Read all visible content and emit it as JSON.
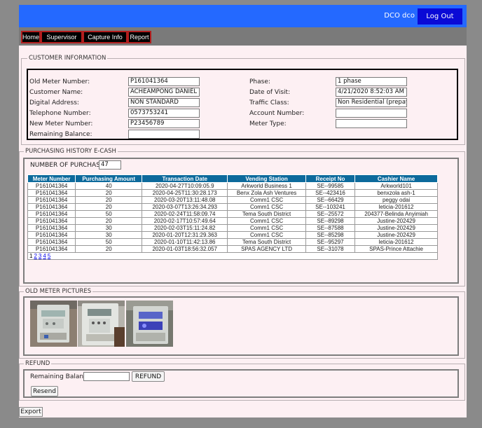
{
  "header": {
    "user": "DCO dco",
    "logout_label": "Log Out"
  },
  "nav": {
    "items": [
      "Home",
      "Supervisor",
      "Capture Info",
      "Report"
    ]
  },
  "customer": {
    "legend": "CUSTOMER INFORMATION",
    "old_meter_label": "Old Meter Number:",
    "old_meter_value": "P161041364",
    "name_label": "Customer Name:",
    "name_value": "ACHEAMPONG DANIEL",
    "digital_label": "Digital Address:",
    "digital_value": "NON STANDARD",
    "phone_label": "Telephone Number:",
    "phone_value": " 0573753241",
    "new_meter_label": "New Meter Number:",
    "new_meter_value": "P23456789",
    "balance_label": "Remaining Balance:",
    "balance_value": "",
    "phase_label": "Phase:",
    "phase_value": "1 phase",
    "visit_label": "Date of Visit:",
    "visit_value": "4/21/2020 8:52:03 AM",
    "traffic_label": "Traffic Class:",
    "traffic_value": "Non Residential (prepaym",
    "account_label": "Account Number:",
    "account_value": "",
    "meter_type_label": "Meter Type:",
    "meter_type_value": ""
  },
  "history": {
    "legend": "PURCHASING HISTORY E-CASH",
    "count_label": "NUMBER OF PURCHASES",
    "count_value": "47",
    "columns": [
      "Meter Number",
      "Purchasing Amount",
      "Transaction Date",
      "Vending Station",
      "Receipt No",
      "Cashier Name"
    ],
    "rows": [
      [
        "P161041364",
        "40",
        "2020-04-27T10:09:05.9",
        "Arkworld Business 1",
        "SE--99585",
        "Arkworld101"
      ],
      [
        "P161041364",
        "20",
        "2020-04-25T11:30:28.173",
        "Benx Zola Ash Ventures",
        "SE--423416",
        "benxzola ash-1"
      ],
      [
        "P161041364",
        "20",
        "2020-03-20T13:11:48.08",
        "Comm1 CSC",
        "SE--66429",
        "peggy odai"
      ],
      [
        "P161041364",
        "20",
        "2020-03-07T13:26:34.293",
        "Comm1 CSC",
        "SE--103241",
        "leticia-201612"
      ],
      [
        "P161041364",
        "50",
        "2020-02-24T11:58:09.74",
        "Tema South District",
        "SE--25572",
        "204377-Belinda Anyimiah"
      ],
      [
        "P161041364",
        "20",
        "2020-02-17T10:57:49.64",
        "Comm1 CSC",
        "SE--89298",
        "Justine-202429"
      ],
      [
        "P161041364",
        "30",
        "2020-02-03T15:11:24.82",
        "Comm1 CSC",
        "SE--87588",
        "Justine-202429"
      ],
      [
        "P161041364",
        "30",
        "2020-01-20T12:31:29.363",
        "Comm1 CSC",
        "SE--85298",
        "Justine-202429"
      ],
      [
        "P161041364",
        "50",
        "2020-01-10T11:42:13.86",
        "Tema South District",
        "SE--95297",
        "leticia-201612"
      ],
      [
        "P161041364",
        "20",
        "2020-01-03T18:56:32.057",
        "SPAS AGENCY LTD",
        "SE--31078",
        "SPAS-Prince Attachie"
      ]
    ],
    "pages": [
      "1",
      "2",
      "3",
      "4",
      "5"
    ]
  },
  "pictures": {
    "legend": "OLD METER PICTURES",
    "items": [
      "meter-photo-1",
      "meter-photo-2",
      "meter-photo-3"
    ]
  },
  "refund": {
    "legend": "REFUND",
    "balance_label": "Remaining Balance:",
    "balance_value": "",
    "refund_label": "REFUND",
    "resend_label": "Resend"
  },
  "footer": {
    "export_label": "Export"
  },
  "colors": {
    "topbar": "#2469ff",
    "logout": "#0a0ad6",
    "table_header": "#0d6a9c",
    "panel_bg": "#fdf0f3",
    "nav_border": "#b21e1e"
  }
}
